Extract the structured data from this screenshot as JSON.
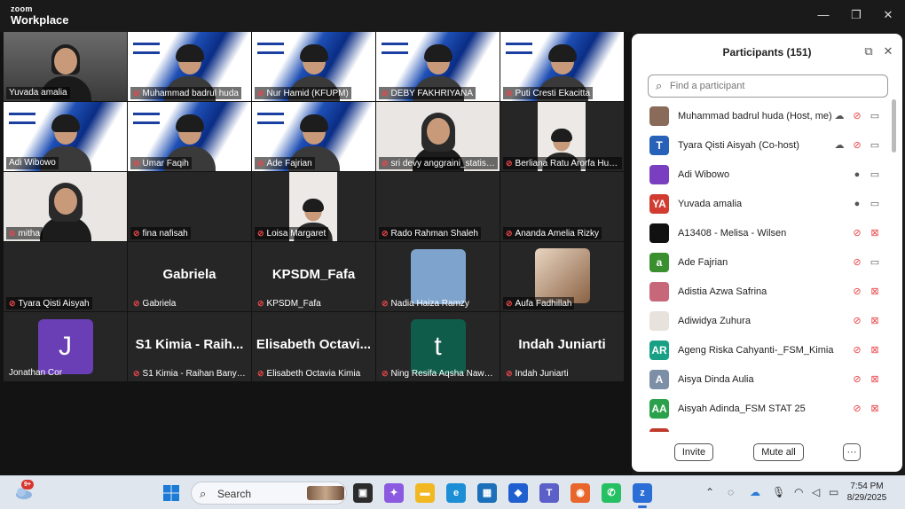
{
  "window": {
    "brand_top": "zoom",
    "brand_bottom": "Workplace",
    "minimize": "—",
    "maximize": "❐",
    "close": "✕"
  },
  "tiles": [
    {
      "name": "Yuvada amalia",
      "muted": false,
      "style": "dark",
      "active": true
    },
    {
      "name": "Muhammad badrul huda",
      "muted": true,
      "style": "webinar"
    },
    {
      "name": "Nur Hamid (KFUPM)",
      "muted": true,
      "style": "webinar"
    },
    {
      "name": "DEBY FAKHRIYANA",
      "muted": true,
      "style": "webinar"
    },
    {
      "name": "Puti Cresti Ekacitta",
      "muted": true,
      "style": "webinar"
    },
    {
      "name": "Adi Wibowo",
      "muted": false,
      "style": "webinar"
    },
    {
      "name": "Umar Faqih",
      "muted": true,
      "style": "webinar"
    },
    {
      "name": "Ade Fajrian",
      "muted": true,
      "style": "webinar"
    },
    {
      "name": "sri devy anggraini_statisti...",
      "muted": true,
      "style": "light"
    },
    {
      "name": "Berliana Ratu Arorfa Huta...",
      "muted": true,
      "style": "portrait"
    },
    {
      "name": "mitha",
      "muted": true,
      "style": "light"
    },
    {
      "name": "fina nafisah",
      "muted": true,
      "style": "empty"
    },
    {
      "name": "Loisa Margaret",
      "muted": true,
      "style": "portrait"
    },
    {
      "name": "Rado Rahman Shaleh",
      "muted": true,
      "style": "empty"
    },
    {
      "name": "Ananda Amelia Rizky",
      "muted": true,
      "style": "empty"
    },
    {
      "name": "Tyara Qisti Aisyah",
      "muted": true,
      "style": "empty"
    },
    {
      "name": "Gabriela",
      "muted": true,
      "style": "bigname",
      "big": "Gabriela"
    },
    {
      "name": "KPSDM_Fafa",
      "muted": true,
      "style": "bigname",
      "big": "KPSDM_Fafa"
    },
    {
      "name": "Nadia Haiza Ramzy",
      "muted": true,
      "style": "avatar",
      "avatar_color": "#7ea3cc",
      "letter": ""
    },
    {
      "name": "Aufa Fadhillah",
      "muted": true,
      "style": "photo"
    },
    {
      "name": "Jonathan Cor",
      "muted": false,
      "style": "avatar",
      "avatar_color": "#6a3fb6",
      "letter": "J"
    },
    {
      "name": "S1 Kimia - Raihan Banyu ...",
      "muted": true,
      "style": "bigname",
      "big": "S1 Kimia - Raih..."
    },
    {
      "name": "Elisabeth Octavia Kimia",
      "muted": true,
      "style": "bigname",
      "big": "Elisabeth Octavi..."
    },
    {
      "name": "Ning Resifa Aqsha Nawaya",
      "muted": true,
      "style": "avatar",
      "avatar_color": "#0f5c4a",
      "letter": "t"
    },
    {
      "name": "Indah Juniarti",
      "muted": true,
      "style": "bigname",
      "big": "Indah Juniarti"
    }
  ],
  "panel": {
    "title": "Participants (151)",
    "search_placeholder": "Find a participant",
    "participants": [
      {
        "name": "Muhammad badrul huda (Host, me)",
        "av": "",
        "color": "#8a6a58",
        "mic": "muted",
        "cam": "on",
        "cloud": true
      },
      {
        "name": "Tyara Qisti Aisyah (Co-host)",
        "av": "T",
        "color": "#2862b8",
        "mic": "muted",
        "cam": "on",
        "cloud": true
      },
      {
        "name": "Adi Wibowo",
        "av": "",
        "color": "#7a3fc0",
        "mic": "on",
        "cam": "on"
      },
      {
        "name": "Yuvada amalia",
        "av": "YA",
        "color": "#d23b30",
        "mic": "on",
        "cam": "on"
      },
      {
        "name": "A13408 - Melisa - Wilsen",
        "av": "",
        "color": "#111111",
        "mic": "muted",
        "cam": "off"
      },
      {
        "name": "Ade Fajrian",
        "av": "a",
        "color": "#3a8f2f",
        "mic": "muted",
        "cam": "on"
      },
      {
        "name": "Adistia Azwa Safrina",
        "av": "",
        "color": "#c7677a",
        "mic": "muted",
        "cam": "off"
      },
      {
        "name": "Adiwidya Zuhura",
        "av": "",
        "color": "#e8e2dc",
        "mic": "muted",
        "cam": "off"
      },
      {
        "name": "Ageng Riska Cahyanti-_FSM_Kimia",
        "av": "AR",
        "color": "#17a084",
        "mic": "muted",
        "cam": "off"
      },
      {
        "name": "Aisya Dinda Aulia",
        "av": "A",
        "color": "#7d8fa6",
        "mic": "muted",
        "cam": "off"
      },
      {
        "name": "Aisyah Adinda_FSM STAT 25",
        "av": "AA",
        "color": "#2aa14a",
        "mic": "muted",
        "cam": "off"
      },
      {
        "name": "",
        "av": "",
        "color": "#c0392b",
        "mic": "",
        "cam": ""
      }
    ],
    "invite": "Invite",
    "mute_all": "Mute all",
    "more": "···"
  },
  "taskbar": {
    "weather_badge": "9+",
    "search_label": "Search",
    "time": "7:54 PM",
    "date": "8/29/2025"
  }
}
